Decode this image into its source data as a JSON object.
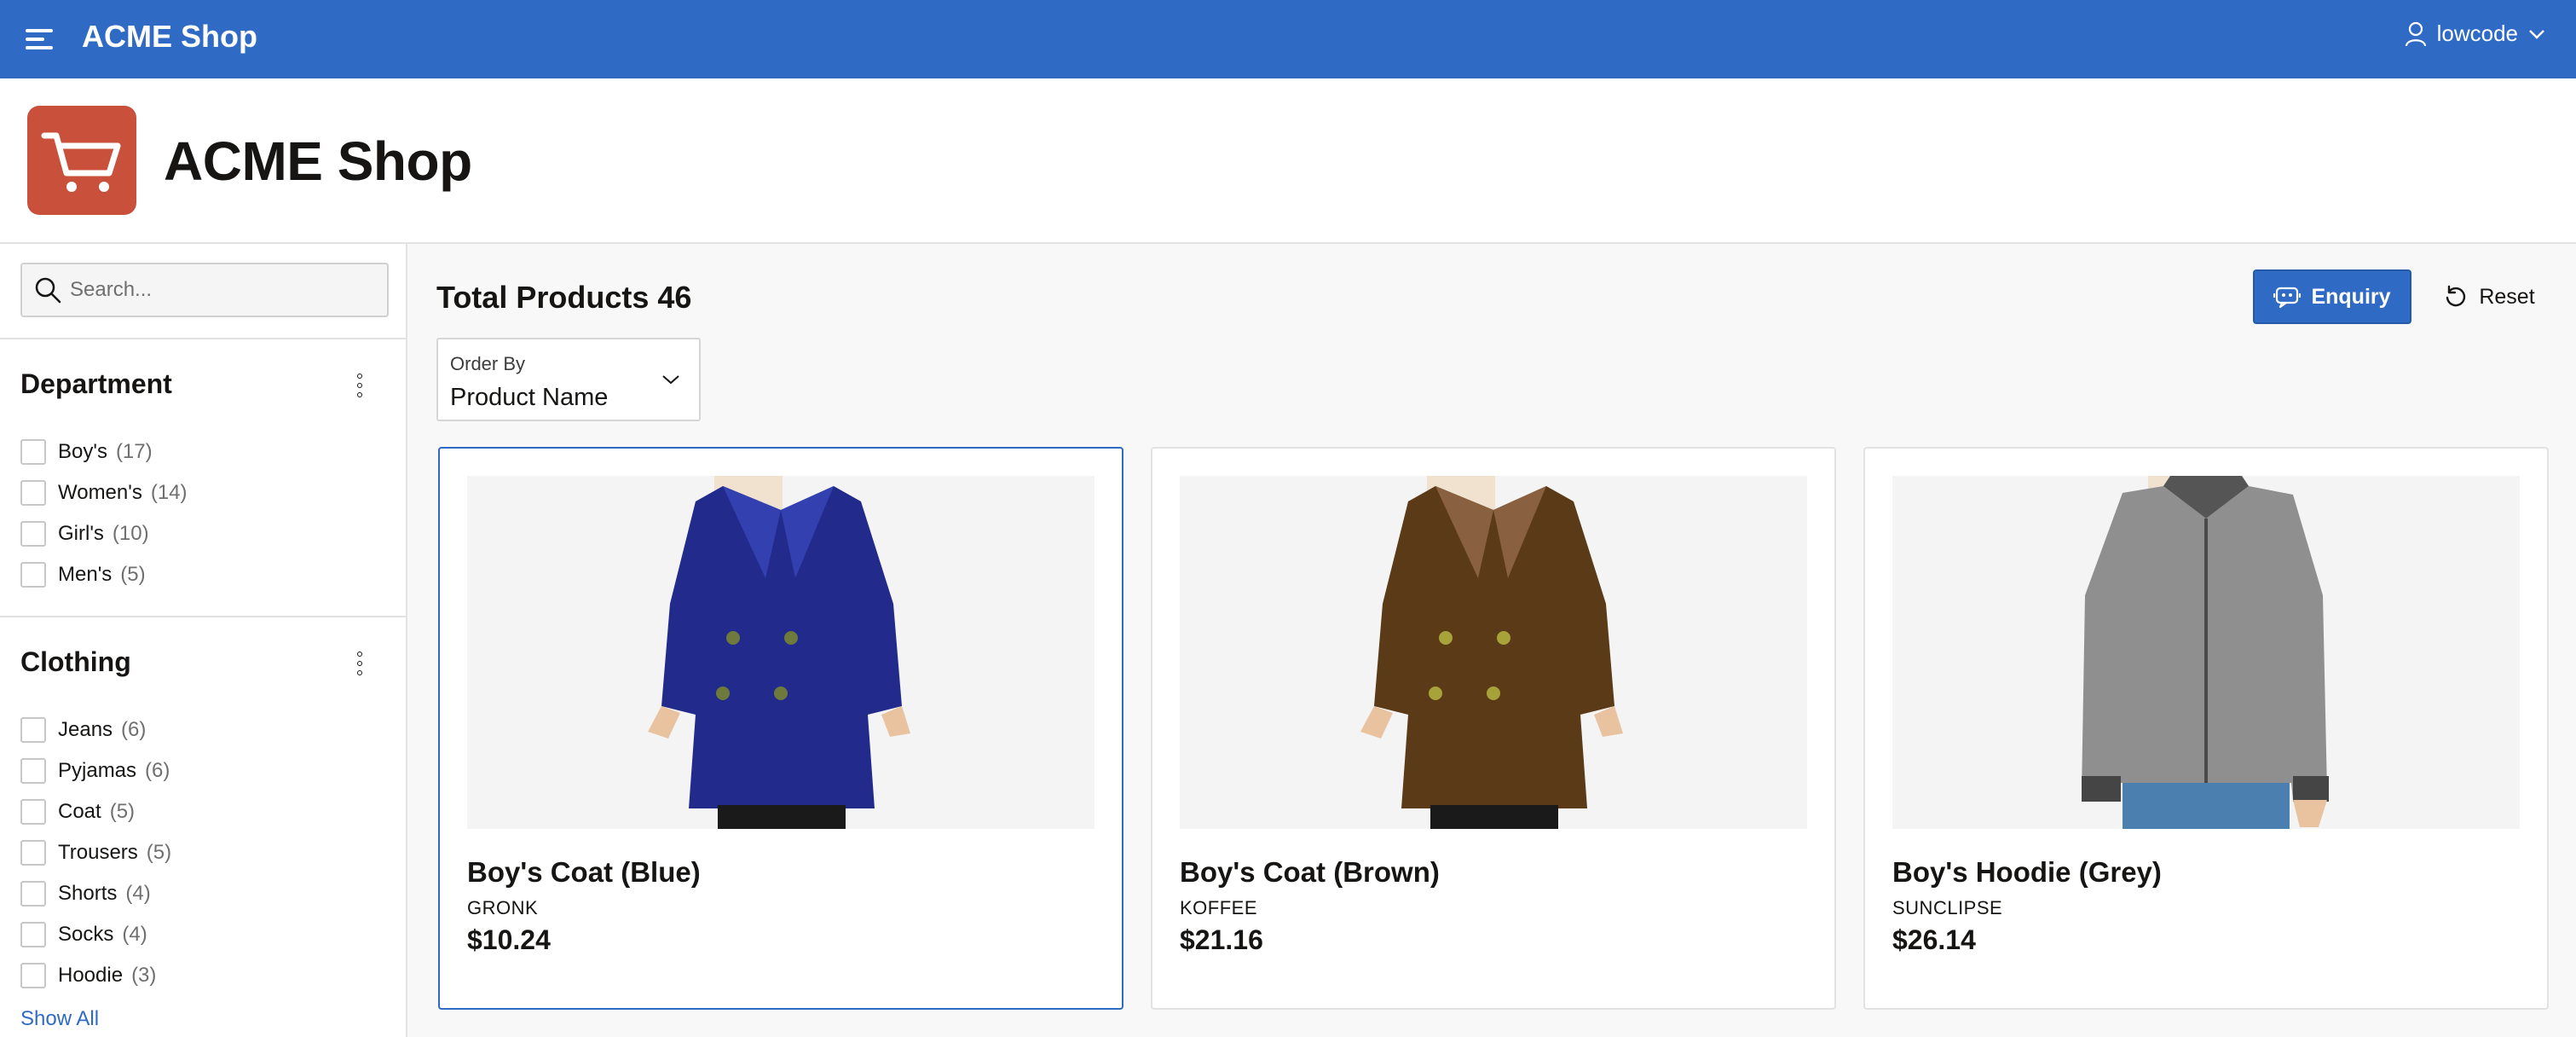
{
  "app": {
    "title": "ACME Shop",
    "user": "lowcode"
  },
  "page": {
    "title": "ACME Shop"
  },
  "search": {
    "placeholder": "Search..."
  },
  "facets": {
    "department": {
      "title": "Department",
      "items": [
        {
          "label": "Boy's",
          "count": "(17)"
        },
        {
          "label": "Women's",
          "count": "(14)"
        },
        {
          "label": "Girl's",
          "count": "(10)"
        },
        {
          "label": "Men's",
          "count": "(5)"
        }
      ]
    },
    "clothing": {
      "title": "Clothing",
      "items": [
        {
          "label": "Jeans",
          "count": "(6)"
        },
        {
          "label": "Pyjamas",
          "count": "(6)"
        },
        {
          "label": "Coat",
          "count": "(5)"
        },
        {
          "label": "Trousers",
          "count": "(5)"
        },
        {
          "label": "Shorts",
          "count": "(4)"
        },
        {
          "label": "Socks",
          "count": "(4)"
        },
        {
          "label": "Hoodie",
          "count": "(3)"
        }
      ],
      "show_all": "Show All"
    }
  },
  "results": {
    "total_label": "Total Products 46",
    "enquiry_label": "Enquiry",
    "reset_label": "Reset",
    "order_by": {
      "label": "Order By",
      "value": "Product Name"
    }
  },
  "products": [
    {
      "name": "Boy's Coat (Blue)",
      "brand": "GRONK",
      "price": "$10.24",
      "color": "#222a8c",
      "selected": true
    },
    {
      "name": "Boy's Coat (Brown)",
      "brand": "KOFFEE",
      "price": "$21.16",
      "color": "#5a3a17",
      "selected": false
    },
    {
      "name": "Boy's Hoodie (Grey)",
      "brand": "SUNCLIPSE",
      "price": "$26.14",
      "color": "#8f8f8f",
      "selected": false
    }
  ],
  "colors": {
    "accent": "#2f6bc5",
    "logo": "#c9513b"
  }
}
